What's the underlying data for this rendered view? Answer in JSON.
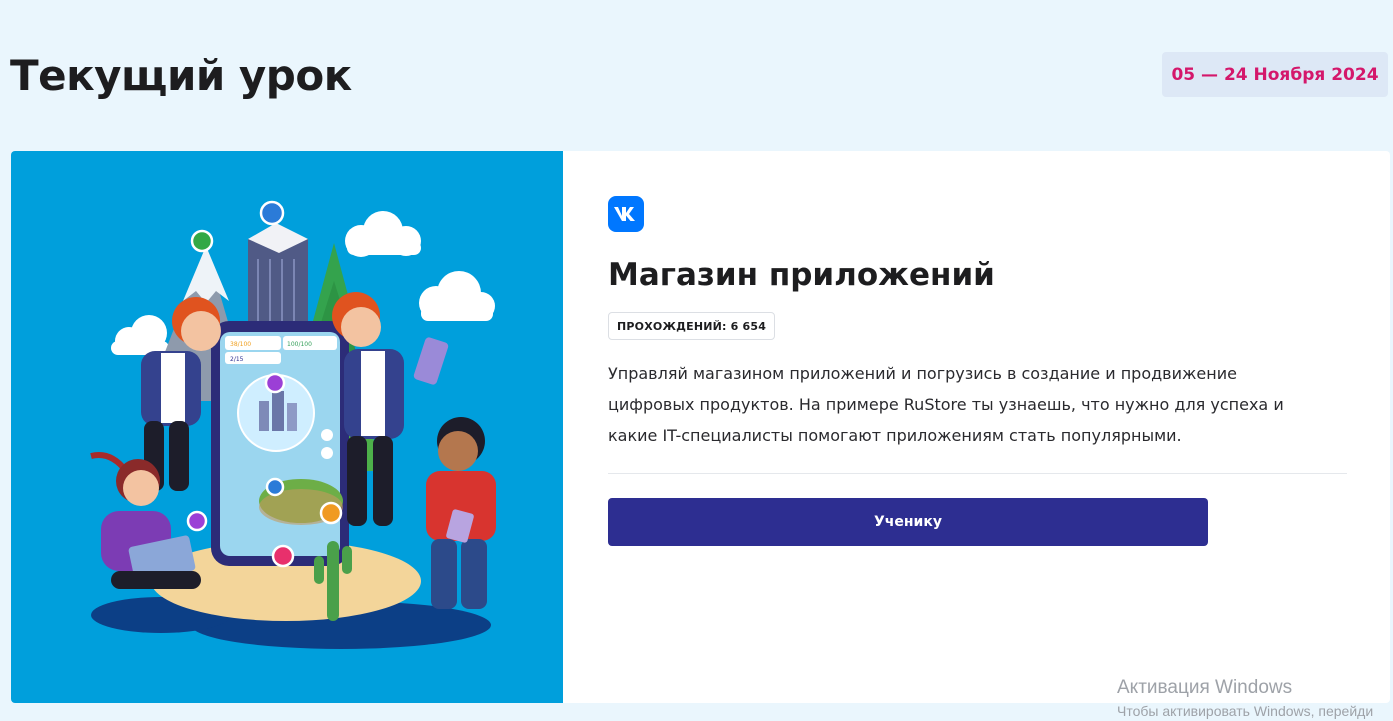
{
  "header": {
    "title": "Текущий урок",
    "dates": "05 — 24 Ноября 2024"
  },
  "card": {
    "logo_icon": "vk-logo-icon",
    "title": "Магазин приложений",
    "completions": "ПРОХОЖДЕНИЙ: 6 654",
    "description": "Управляй магазином приложений и погрузись в создание и продвижение цифровых продуктов. На примере RuStore ты узнаешь, что нужно для успеха и какие IT-специалисты помогают приложениям стать популярными.",
    "button_label": "Ученику",
    "illustration": {
      "phone_stats": [
        "38/100",
        "100/100",
        "2/15"
      ],
      "background_color": "#009fdc"
    }
  },
  "watermark": {
    "title": "Активация Windows",
    "subtitle": "Чтобы активировать Windows, перейди"
  },
  "colors": {
    "accent": "#d4176b",
    "button": "#2d2e91",
    "vk_blue": "#0077ff",
    "page_bg": "#eaf6fd"
  }
}
